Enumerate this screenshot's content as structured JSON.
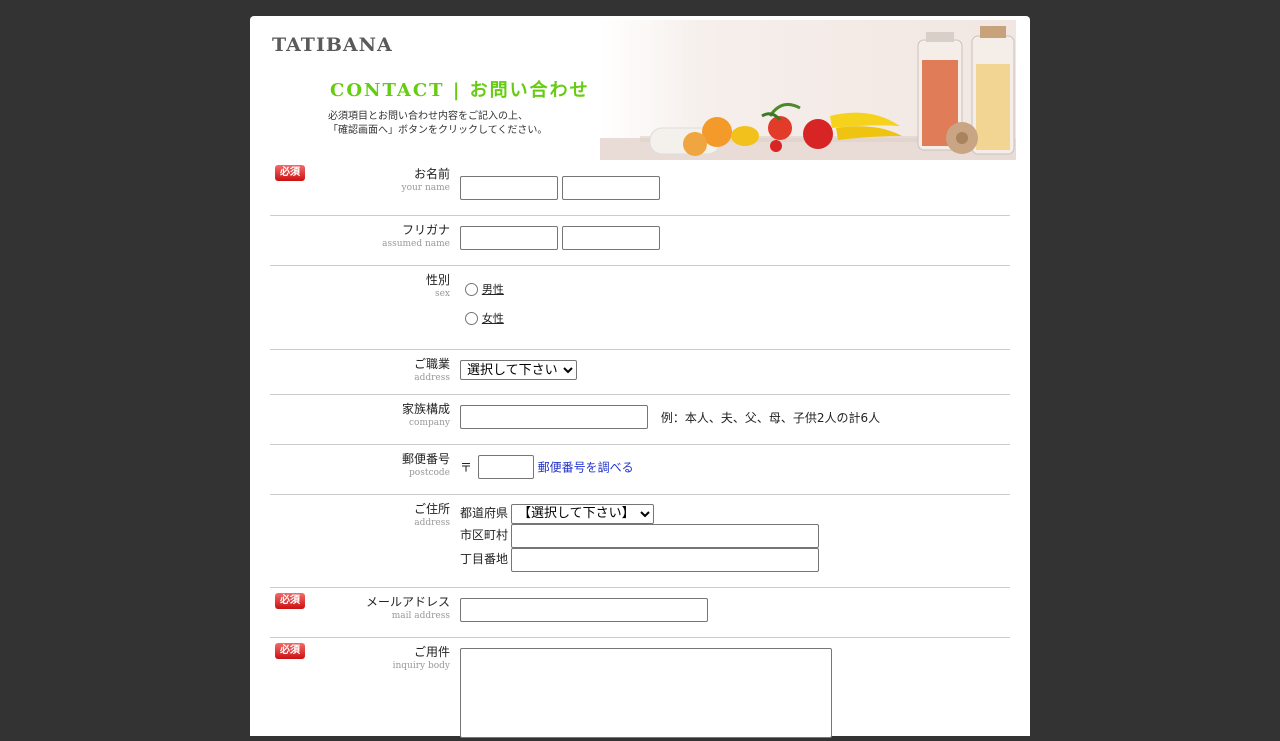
{
  "brand": {
    "logo": "TATIBANA"
  },
  "header": {
    "title": "CONTACT | お問い合わせ",
    "intro_line1": "必須項目とお問い合わせ内容をご記入の上、",
    "intro_line2": "「確認画面へ」ボタンをクリックしてください。"
  },
  "required_badge": "必須",
  "fields": {
    "name": {
      "label": "お名前",
      "sub": "your name",
      "last_value": "",
      "first_value": ""
    },
    "furigana": {
      "label": "フリガナ",
      "sub": "assumed name",
      "last_value": "",
      "first_value": ""
    },
    "sex": {
      "label": "性別",
      "sub": "sex",
      "options": [
        "男性",
        "女性"
      ]
    },
    "job": {
      "label": "ご職業",
      "sub": "address",
      "selected": "選択して下さい"
    },
    "family": {
      "label": "家族構成",
      "sub": "company",
      "value": "",
      "example": "例：本人、夫、父、母、子供2人の計6人"
    },
    "postcode": {
      "label": "郵便番号",
      "sub": "postcode",
      "prefix": "〒",
      "value": "",
      "lookup_link": "郵便番号を調べる"
    },
    "address": {
      "label": "ご住所",
      "sub": "address",
      "prefecture_label": "都道府県",
      "prefecture_selected": "【選択して下さい】",
      "city_label": "市区町村",
      "city_value": "",
      "street_label": "丁目番地",
      "street_value": ""
    },
    "email": {
      "label": "メールアドレス",
      "sub": "mail address",
      "value": ""
    },
    "inquiry": {
      "label": "ご用件",
      "sub": "inquiry body",
      "value": ""
    }
  },
  "colors": {
    "background": "#333333",
    "accent": "#66cc11",
    "badge": "#dd2222",
    "link": "#2233cc"
  }
}
